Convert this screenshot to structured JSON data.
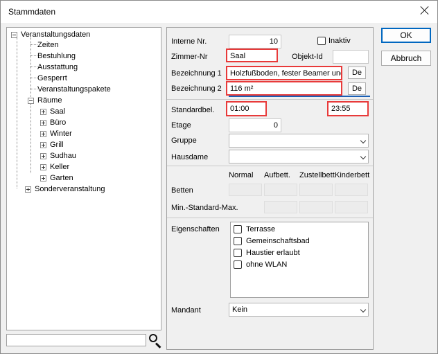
{
  "window": {
    "title": "Stammdaten"
  },
  "tree": {
    "root": "Veranstaltungsdaten",
    "root_children": [
      "Zeiten",
      "Bestuhlung",
      "Ausstattung",
      "Gesperrt",
      "Veranstaltungspakete"
    ],
    "raeume": "Räume",
    "raeume_children": [
      "Saal",
      "Büro",
      "Winter",
      "Grill",
      "Sudhau",
      "Keller",
      "Garten"
    ],
    "sonder": "Sonderveranstaltung"
  },
  "search": {
    "value": ""
  },
  "form": {
    "interne_nr_label": "Interne Nr.",
    "interne_nr_value": "10",
    "inaktiv_label": "Inaktiv",
    "zimmer_nr_label": "Zimmer-Nr",
    "zimmer_nr_value": "Saal",
    "objekt_id_label": "Objekt-Id",
    "objekt_id_value": "",
    "bezeichnung1_label": "Bezeichnung 1",
    "bezeichnung1_value": "Holzfußboden, fester Beamer und",
    "bezeichnung2_label": "Bezeichnung 2",
    "bezeichnung2_value": "116 m²",
    "de_label": "De",
    "standardbel_label": "Standardbel.",
    "standardbel_from": "01:00",
    "standardbel_to": "23:55",
    "etage_label": "Etage",
    "etage_value": "0",
    "gruppe_label": "Gruppe",
    "gruppe_value": "",
    "hausdame_label": "Hausdame",
    "hausdame_value": "",
    "cols": [
      "Normal",
      "Aufbett.",
      "Zustellbett",
      "Kinderbett"
    ],
    "betten_label": "Betten",
    "min_std_max_label": "Min.-Standard-Max.",
    "eigenschaften_label": "Eigenschaften",
    "eigenschaften": [
      "Terrasse",
      "Gemeinschaftsbad",
      "Haustier erlaubt",
      "ohne WLAN"
    ],
    "mandant_label": "Mandant",
    "mandant_value": "Kein"
  },
  "buttons": {
    "ok": "OK",
    "abbruch": "Abbruch"
  }
}
